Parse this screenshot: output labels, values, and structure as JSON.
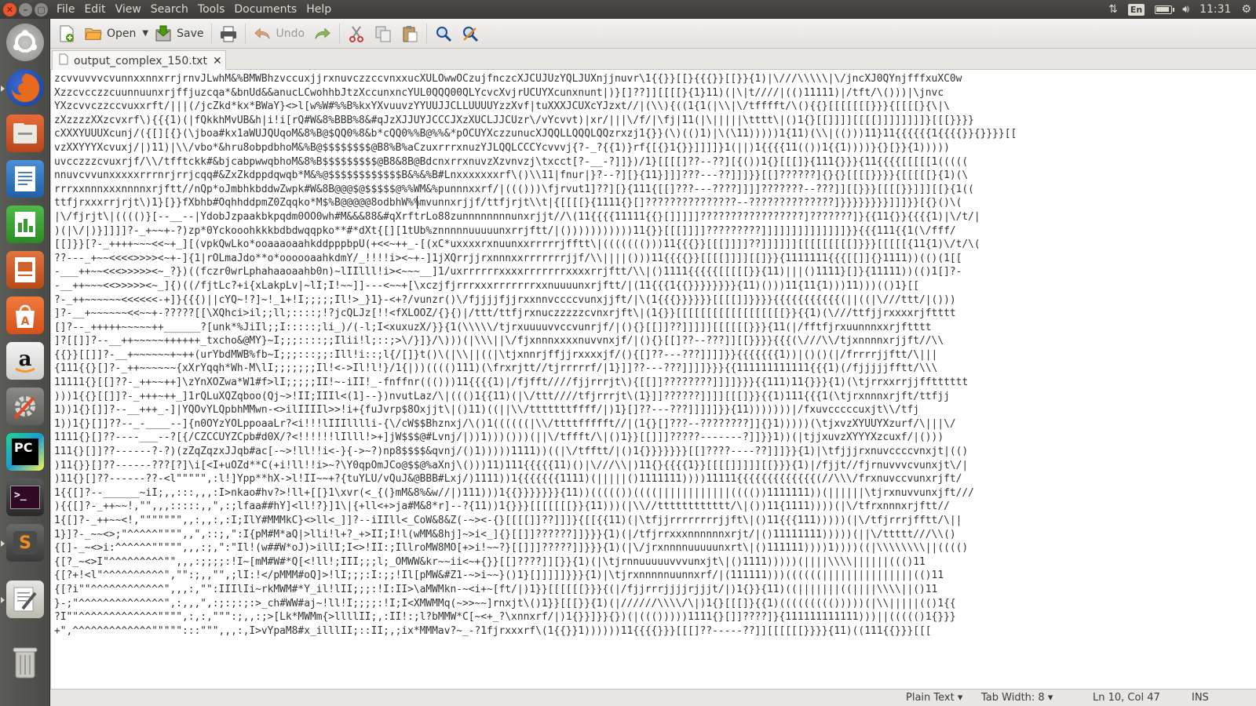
{
  "panel": {
    "menus": [
      "File",
      "Edit",
      "View",
      "Search",
      "Tools",
      "Documents",
      "Help"
    ],
    "keyboard": "En",
    "clock": "11:31",
    "icons": [
      "network-updown-icon",
      "battery-icon",
      "volume-icon",
      "power-gear-icon"
    ]
  },
  "launcher": {
    "items": [
      "dash-home-icon",
      "firefox-icon",
      "files-icon",
      "writer-icon",
      "calc-icon",
      "impress-icon",
      "software-center-icon",
      "amazon-icon",
      "settings-icon",
      "pycharm-icon",
      "terminal-icon",
      "sublime-icon",
      "text-editor-icon",
      "trash-icon"
    ]
  },
  "toolbar": {
    "open_label": "Open",
    "save_label": "Save",
    "undo_label": "Undo"
  },
  "tab": {
    "title": "output_complex_150.txt"
  },
  "editor": {
    "lines": [
      "zcvvuvvvcvunnxxnnxrrjrnvJLwhM&%BMWBhzvccuxjjrxnuvczzccvnxxucXULOwwOCzujfnczcXJCUJUzYQLJUXnjjnuvr\\1{{}}[[}{{{}}[[}}{1)|\\///\\\\\\\\\\|\\/jncXJ0QYnjfffxuXC0w",
      "Xzzcvcczzcuunnuunxrjffjuzcqa*&bnUd&&anucLCwohhbJtzXccunxncYUL0QQQ00QLYcvcXvjrUCUYXcunxnunt|)}[]??]][[[[}{1}11)(|\\|t////|(()11111)|/tft/\\()))|\\jnvc",
      "YXzcvvczzccvuxxrft/|||(/jcZkd*kx*BWaY}<>l[w%W#%%B%kxYXvuuvzYYUUJJCLLUUUUYzzXvf|tuXXXJCUXcYJzxt//|(\\\\){((1{1(|\\\\|\\/tfffft/\\(){{}[[[[[[[}}}{[[[[}{\\|\\",
      "zXzzzzXXzcvxrf\\){{{1)(|fQkkhMvUB&h|i!i[rQ#W&8%BBB%8&#qJzXJJUYJCCCJXzXUCLJJCUzr\\/vYcvvt)|xr/|||\\/f/|\\fj|11(|\\|||||\\tttt\\|()1{}[[]]]][[[[]]]]]]]]}[[[}}}}",
      "cXXXYUUUXcunj/({[][{}(\\jboa#kx1aWUJQUqoM&8%B@$QQ0%8&b*cQQ0%%B@%%&*pOCUYXczzunucXJQQLLQQQLQQzrxzj1{}}(\\)(()1)|\\(\\11)))))1{11)(\\\\|(()))11}11{{{{{{1{{{{}}{}}}}[[",
      "vzXXYYYXcvuxj/|)11)|\\\\/vbo*&hru8obpdbhoM&%B@$$$$$$$$@B8%B%aCzuxrrrxnuzYJLQQLCCCYcvvvj{?-_?{{1)}rf{[{}1{}}]]]]}1(||)1{{{{11(())1{{1))))}{}[}}{1)))))",
      "uvcczzzcvuxrjf/\\\\/tfftckk#&bjcabpwwqbhoM&8%B$$$$$$$$$@B8&8B@BdcnxrrxnuvzXzvnvzj\\txcct[?-__-?]]})/1}[[[[]??--??][{())1{}[[[]}{111{}}}{11{{{{[[[[[1(((((",
      "nnuvcvvunxxxxxrrrnrjrrjcqq#&ZxZkdppdqwqb*M&%@$$$$$$$$$$$$B&%&%B#Lnxxxxxxxrf\\()\\\\11|fnur|}?--?][}{11}]]]???---??]]]}}[[]??????]{}{}[[[[}}}}{[[[[[}{1)(\\",
      "rrrxxnnnxxxnnnnxrjftt//nQp*oJmbhkbddwZwpk#W&8B@@@$@$$$$$@%%WM&%punnnxxrf/|((()))\\fjrvut1]??][}{111{[[]???---????]]]]???????--???]][[}}}[[[[}}]]][[}{1((",
      "ttfjrxxxrrjrjt\\)1}[}}fXbhb#OqhhddpmZ0Zqqko*M$%B@@@@@8odbhW%%mvunnxrjjf/ttfjrjt\\\\t|{[[[[}{1111{}[]???????????????--??????????????]}}}}}}}}]]]}}[{}()\\(",
      "|\\/fjrjt\\|(((()}[--__--|YdobJzpaakbkpqdm0OO0wh#M&&&88&#qXrftrLo88zunnnnnnnnunxrjjt//\\(11{{{{11111{{}[]]]]]?????????????????]???????]}{{11{}}{{{{1)|\\/t/|",
      ")(|\\/|)}]]]]?-_+~~+-?)zp*0Yckooohkkkbdbdwqqpko**#*dXt{[][1tUb%znnnnnuuuuunxrrjftt/|()))))))))))11{}}[[[]]]]?????????]]]]]]]]]]]]]]}}{{{111{{1(\\/fff/",
      "[[]}}[?-_++++~~~<<~+_][(vpkQwLko*ooaaaoaahkddpppbpU(+<<~++_-[(xC*uxxxxrxnuunxxrrrrrjfftt\\|((((((()))11{{{}}[[[]]]]??]]]]]][[[[[[[[[]}}}[[[[[{11{1)\\/t/\\(",
      "??---_+~~<<<<>>>><~+-]{1|rOLmaJdo**o*oooooaahkdmY/_!!!!i><~+-]1jXQrrjjrxnnnxxrrrrrrrjjf/\\\\||||()))11{{{{}}[[[[]]]][[]}}{1111111{{{[[]]{}1111))(()(1[[",
      "-___++~~<<<>>>>><~_?})((fczr0wrLphahaaoaahb0n)~lIIlll!i><~~~__]1/uxrrrrrrxxxxrrrrrrrxxxxrrjftt/\\\\|()1111{{{{{[[[[[}}{11)|||()1111}[]}{11111))(()1[]?-",
      "-__++~~~<<>>>>><~_]{)((/fjtLc?+i{xLakpLv|~lI;I!~~]]---<~~+[\\xczjfjrrrxxxrrrrrrrxxnuuuunxrjftt/|(11{{{1{{}}}}}}}}{11)()))11{11{1)))11)))(()1}[[",
      "?-_++~~~~~~<<<<<<-+]}{{{)||cYQ~!?]~!_1+!I;;;;;Il!>_}1}-<+?/vunzr()\\/fjjjjfjjrxxnnvccccvunxjjft/|\\(1{{{}}}}}}[[[[]]}}}}{{{{{{{{{{{(||((|\\///ttt/|()))",
      "]?-__+~~~~~~<<~~+-?????[[\\XQhci>il;;ll;::::;!?jcQLJz[!!<fXLOOZ/{}{)|/ttt/ttfjrxnuczzzzzcvnxrjft\\|(1{}}[[[[[[[[[[[[[[[[[[}}{{1)(\\///ttfjjrxxxxrjftttt",
      "[]?--_+++++~~~~~++______?[unk*%JiIl;;I:::::;li_)/(-l;I<xuxuzX/}}{1(\\\\\\\\\\/tjrxuuuuvvccvunrjf/|(){}[[]]??]]]]][[[[[[}}}{11(|/fftfjrxuunnnxxrjftttt",
      "]?[[]]?--__++~~~~~++++++_txcho&@MY}~I;;;::::;;Ilii!l;::;>\\/}]}/\\)))(|\\\\\\||\\/fjxnnnxxxxnuvvnxjf/|(){}[[]??--???]][[}}}}{{{(\\///\\\\/tjxnnnnxrjjft//\\\\",
      "{{}}[[]]?-__+~~~~~~+~++(urYbdMWB%fb~I;;;:::;;:Ill!i::;l{/[]}t()\\(|\\\\||((|\\tjxnnrjffjjrxxxxjf/(){[]??---???]]]]}}{{{{{{{1))|()()(|/frrrrjjftt/\\|||",
      "{111{{}[]?-_++~~~~~~{xXrYqqh*Wh-M\\lI;;;;;;;Il!<->Il!l!}/1{|))(((()111)(\\frxrjtt//tjrrrrrf/|1}]]??---???]]]]}}}{{111111111111{{{1)(/fjjjjjfftt/\\\\\\",
      "11111{}[[]??-_++~~++]\\zYnXOZwa*W1#f>lI;;;;;II!~-iII!_-fnffnr((()))11{{{{1)|/fjfft////fjjrrrjt\\){[[]]????????]]]]}}}{{111)11{}}}{1)(\\tjrrxxrrjjfftttttt",
      ")))1{{}[[]]?-_+++~++_]1rQLuXQZqboo(Qj~>!II;IIIl<(1]--})nvutLaz/\\|((()1{{11)(|\\/ttt////tfjrrrjt\\(1}]]??????]]]][[[]}}{{1)111{{{1(\\tjrxnnnxrjft/ttfjj",
      "1))1{}[]]?--__+++_-]|YQOvYLQpbhMMwn-<>ilIIIIl>>!i+{fuJvrp$8Oxjjt\\|()11)((||\\\\/tttttttffff/|)1}[]??---???]]]]]}}{11)))))))|/fxuvcccccuxjt\\\\/tfj",
      "1))1{}[]]??--_-____--]{n0OYzYOLppoaaLr?<i!!!lIIIlllli-{\\/cW$$Bhznxj/\\()1((((((|\\\\/ttttffffft//|(1{}[]???--????????]]{}1)))))(\\tjxvzXYUUYXzurf/\\|||\\/",
      "1111{}[]??----___--?[{/CZCCUYZCpb#d0X/?<!!!!!!lIlll!>+]jW$$$@#Lvnj/|))1)))()))(||\\/tffft/\\|()1}}[[]]]?????-------?]]}}1))(|tjjxuvzXYYYXzcuxf/|()))",
      "111{}[]]??------?-?)(zZqZqzxJJqb#ac[-~>!ll!!i<-}{->~?)np8$$$$&qvnj/()1)))))1111))((|\\/tfftt/|()1{}}}}}}}[[]????----??]]]}}{1)|\\tfjjjrxnuvccccvnxjt|(()",
      ")11{}}[]??------???[?]\\i[<I+uOZd**C(+i!ll!!i>~?\\Y0qpOmJCo@$$@%aXnj\\()))11)111{{{{{11)()|\\///\\\\|)11{}{{{{1}}[[[[]]]]][[}}}{1)|/fjjt//fjrnuvvvcvunxjt\\/|",
      ")11{}[]??------??-<l\"\"\"\"\",:l!]Ypp**hX->l!II~~+?{tuYLU/vQuJ&@BBB#Lxj/)1111))1{{{{{{{1111)(|||||()1111111))))11111{{{{{{{{{{{{{(//\\\\\\/frxnuvccvunxrjft/",
      "1{{[]?--______~iI;,,:::,,,:I>nkao#hv?>!ll+[[}1\\xvr(<_{(}mM&8%&w//|)111)))1{{}}}}}}}{11))((((())((((||||||||||||(((())1111111))(||||||\\tjrxnuvvunxjft///",
      "){{[]?-_++~~!,\"\",,,:::::,,\",:;lfaa##hY]<ll!?}]1\\|{+ll<+>ja#M&8*r]--?{11))1{}}}[[[[[[[}}{11)))(|\\\\//tttttttttttt/\\|())11{1111))))(|\\/tfrxnnnxrjftt//",
      "1{[]?-_++~~<!,\"\"\"\"\"\"\",,:,,:,:I;IlY#MMMkC}<>ll<_]]?--iIIll<_CoW&8&Z(-~><-{}[[[[]]??]]]}{[[{{11)(|\\tfjjrrrrrrrrjjft\\|()11{{{111)))))(|\\/tfjrrrjfftt/\\||",
      "1}]?-_~~<>;\"^^^^^\"\"\"\",,\",::;,\":I{pM#M*aQ|>lli!l+?_+>II;I!l(wMM&8hj]~>i<_]{}[[]]??????]]}}}{1)(|/tfjrrxxxnnnnnnxrjt/|()11111111)))))(||\\/ttttt///\\\\()",
      "{[]-_~<>i:^^^^^^\"\"\"\"\",,,:;,\":\"Il!(w##W*oJ)>illI;I<>!II:;IllroMW8MO[+>i!~~?}[[]]]?????]]}}}{1)(|\\/jrxnnnnuuuuunxrt\\|()111111))))1))))((|\\\\\\\\\\\\\\\\||(((()",
      "{[?_~<>I\"^^^^^^^^^\"\",,,:;;;;:!I~[mM#W#*Q[<!ll!;III;;;l;_OMWW&kr~~ii<~+{}}[[]????]][}}{1)(|\\tjrnnuuuuuvvvunxjt\\|()1111)))))(||||\\\\\\\\||||||((()11",
      "{[?+!<l\"^^^^^^^^^^\",\"\":;,,\"\",;lI:!</pMMM#oQ]>!lI;;;:I:;;!Il[pMW&#Z1-~>i~~}()1}[]]]]]}}}{1)|\\tjrxnnnnnuunnxrf/|(111111)))((((((|||||||||||||||(()11",
      "{[?i\"\"^^^^^^^^^^^^\",,,:,\"\":IIIlIi~rkMWM#*Y_il!lII;;;:!I:II>\\aMWMkn-~<i+~[ft/|)1}}[[[[[[}}}{(|/fjjrrrjjjjrjjjt/|)1{}}{11)((|||||||((||||\\\\\\\\||()11",
      "}-;\"^^^^^^^^^^^^^^\",:,,,\",:;:;:;:>_ch#WW#aj~!ll!I;;;;:!I;I<XMWMMq(~>>~~]rnxjt\\()1}}[[[}}{1)(|//////\\\\\\\\/\\|)1{}[[[]}{{1)((((((((()))))(|\\\\|||||(()1{{",
      "?I\"\"^^^^^^^^^^^^^\"\"\"\",:,:,\"\"\":;,,:;>[Lk*MWMm{>llllII;,:II!:;l?bMMW*C[~<+_?\\xnnxrf/|)1{}}]}}{})(|((()))))1111{}[]]????]}{111111111111)))||((((()1{}}}",
      "+\",^^^^^^^^^^^^^\"\"\"\"\":::\"\"\",,,:,I>vYpaM8#x_illlII;::II;,;ix*MMMav?~_-?1fjrxxxrf\\(1{{}}1))))))11{{{{}}}[[[]??-----??]][[[[[[}}}}{11)((111{{}}}[[["
    ]
  },
  "status": {
    "language": "Plain Text",
    "tab_width": "Tab Width: 8",
    "position": "Ln 10, Col 47",
    "mode": "INS"
  }
}
